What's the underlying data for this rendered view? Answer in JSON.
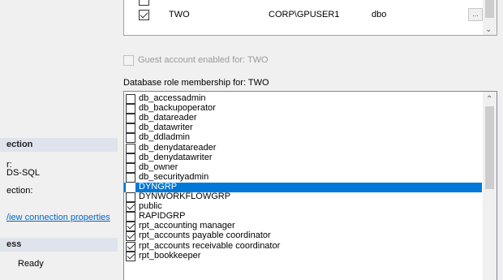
{
  "left_panel": {
    "connection_header": "ection",
    "server_label": "r:",
    "server_value": "DS-SQL",
    "connection_label": "ection:",
    "view_connection_link": "/iew connection properties",
    "progress_header": "ess",
    "status_text": "Ready"
  },
  "user_grid": {
    "partial_row_text": "",
    "row": {
      "checked": true,
      "user": "TWO",
      "login": "CORP\\GPUSER1",
      "schema": "dbo",
      "ellipsis": "..."
    }
  },
  "guest": {
    "label": "Guest account enabled for: TWO",
    "checked": false
  },
  "role_title": "Database role membership for: TWO",
  "roles": [
    {
      "name": "db_accessadmin",
      "checked": false,
      "selected": false
    },
    {
      "name": "db_backupoperator",
      "checked": false,
      "selected": false
    },
    {
      "name": "db_datareader",
      "checked": false,
      "selected": false
    },
    {
      "name": "db_datawriter",
      "checked": false,
      "selected": false
    },
    {
      "name": "db_ddladmin",
      "checked": false,
      "selected": false
    },
    {
      "name": "db_denydatareader",
      "checked": false,
      "selected": false
    },
    {
      "name": "db_denydatawriter",
      "checked": false,
      "selected": false
    },
    {
      "name": "db_owner",
      "checked": false,
      "selected": false
    },
    {
      "name": "db_securityadmin",
      "checked": false,
      "selected": false
    },
    {
      "name": "DYNGRP",
      "checked": false,
      "selected": true
    },
    {
      "name": "DYNWORKFLOWGRP",
      "checked": false,
      "selected": false
    },
    {
      "name": "public",
      "checked": true,
      "selected": false
    },
    {
      "name": "RAPIDGRP",
      "checked": false,
      "selected": false
    },
    {
      "name": "rpt_accounting manager",
      "checked": true,
      "selected": false
    },
    {
      "name": "rpt_accounts payable coordinator",
      "checked": true,
      "selected": false
    },
    {
      "name": "rpt_accounts receivable coordinator",
      "checked": true,
      "selected": false
    },
    {
      "name": "rpt_bookkeeper",
      "checked": true,
      "selected": false
    }
  ],
  "colors": {
    "selection": "#0078d7",
    "link": "#0066cc",
    "section_header": "#dfe3ec"
  }
}
